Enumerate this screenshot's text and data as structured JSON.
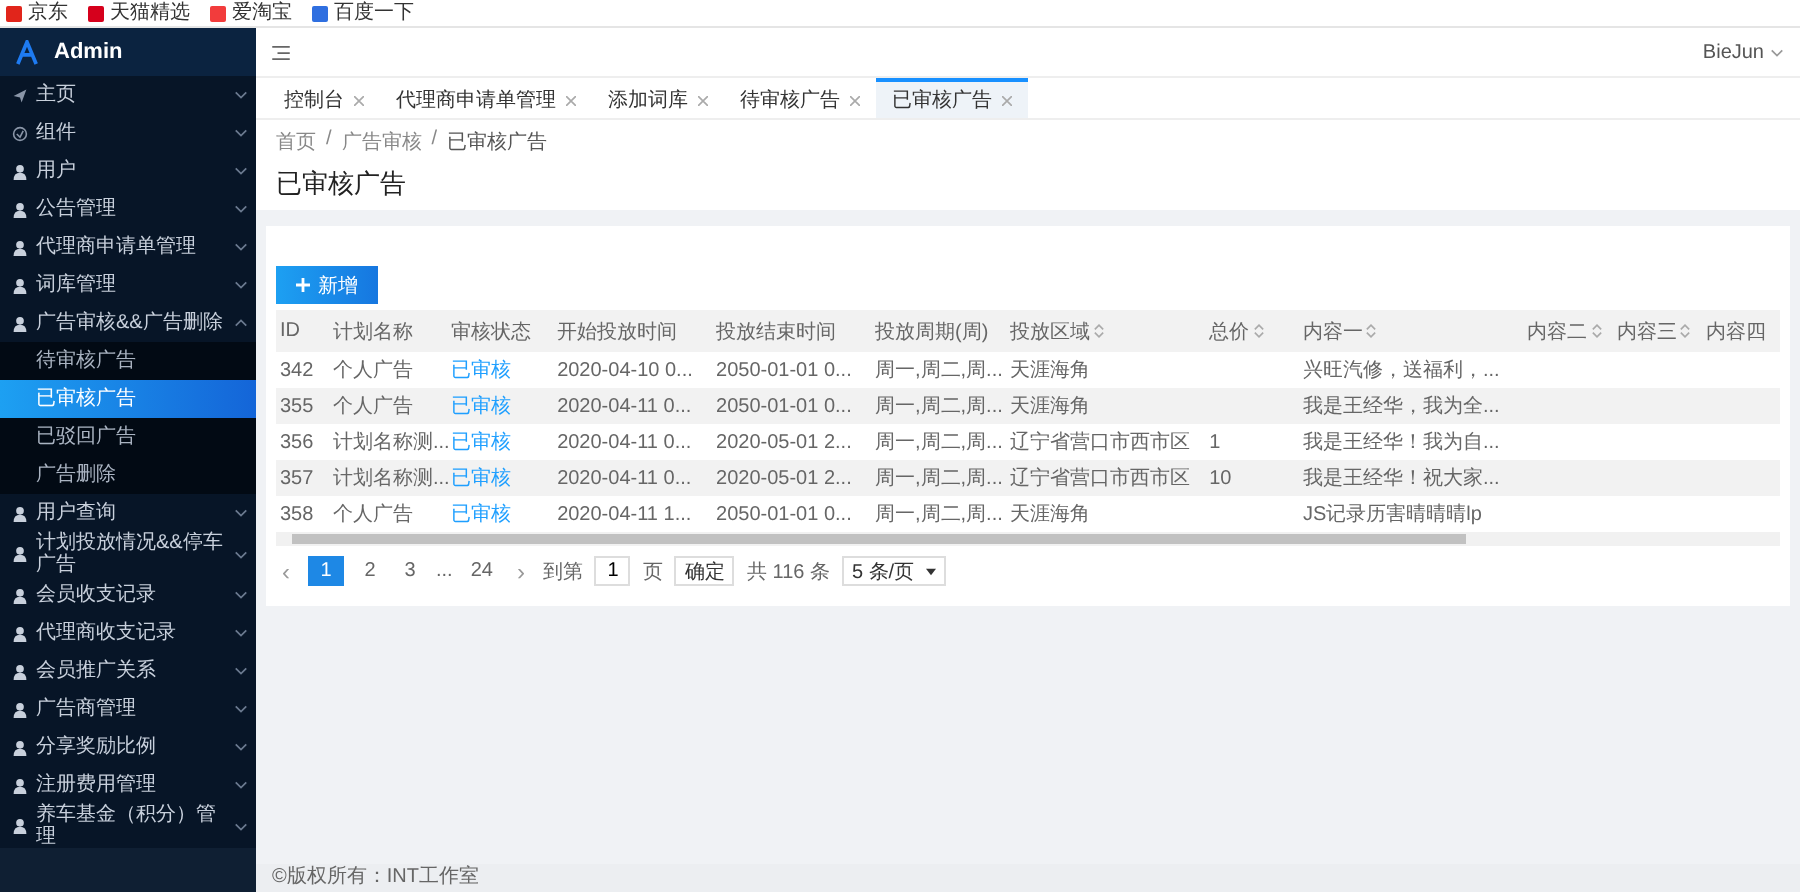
{
  "bookmarks": [
    {
      "label": "京东",
      "color": "#e1251b"
    },
    {
      "label": "天猫精选",
      "color": "#d6001c"
    },
    {
      "label": "爱淘宝",
      "color": "#f23c3c"
    },
    {
      "label": "百度一下",
      "color": "#2f6fe0"
    }
  ],
  "sidebar": {
    "title": "Admin",
    "items": [
      {
        "label": "主页",
        "expanded": false
      },
      {
        "label": "组件",
        "expanded": false
      },
      {
        "label": "用户",
        "expanded": false
      },
      {
        "label": "公告管理",
        "expanded": false
      },
      {
        "label": "代理商申请单管理",
        "expanded": false
      },
      {
        "label": "词库管理",
        "expanded": false
      },
      {
        "label": "广告审核&&广告删除",
        "expanded": true,
        "children": [
          {
            "label": "待审核广告",
            "selected": false
          },
          {
            "label": "已审核广告",
            "selected": true
          },
          {
            "label": "已驳回广告",
            "selected": false
          },
          {
            "label": "广告删除",
            "selected": false
          }
        ]
      },
      {
        "label": "用户查询",
        "expanded": false
      },
      {
        "label": "计划投放情况&&停车广告",
        "expanded": false
      },
      {
        "label": "会员收支记录",
        "expanded": false
      },
      {
        "label": "代理商收支记录",
        "expanded": false
      },
      {
        "label": "会员推广关系",
        "expanded": false
      },
      {
        "label": "广告商管理",
        "expanded": false
      },
      {
        "label": "分享奖励比例",
        "expanded": false
      },
      {
        "label": "注册费用管理",
        "expanded": false
      },
      {
        "label": "养车基金（积分）管理",
        "expanded": false
      }
    ]
  },
  "header": {
    "user": "BieJun"
  },
  "tabs": [
    {
      "label": "控制台",
      "selected": false
    },
    {
      "label": "代理商申请单管理",
      "selected": false
    },
    {
      "label": "添加词库",
      "selected": false
    },
    {
      "label": "待审核广告",
      "selected": false
    },
    {
      "label": "已审核广告",
      "selected": true
    }
  ],
  "breadcrumb": {
    "separator": "/",
    "items": [
      "首页",
      "广告审核",
      "已审核广告"
    ]
  },
  "page_title": "已审核广告",
  "add_button": "新增",
  "table": {
    "columns": [
      {
        "label": "ID",
        "sortable": false
      },
      {
        "label": "计划名称",
        "sortable": false
      },
      {
        "label": "审核状态",
        "sortable": false
      },
      {
        "label": "开始投放时间",
        "sortable": false
      },
      {
        "label": "投放结束时间",
        "sortable": false
      },
      {
        "label": "投放周期(周)",
        "sortable": false
      },
      {
        "label": "投放区域",
        "sortable": true
      },
      {
        "label": "总价",
        "sortable": true
      },
      {
        "label": "内容一",
        "sortable": true
      },
      {
        "label": "内容二",
        "sortable": true
      },
      {
        "label": "内容三",
        "sortable": true
      },
      {
        "label": "内容四",
        "sortable": false
      }
    ],
    "rows": [
      [
        "342",
        "个人广告",
        "已审核",
        "2020-04-10 0...",
        "2050-01-01 0...",
        "周一,周二,周...",
        "天涯海角",
        null,
        "兴旺汽修，送福利，...",
        null,
        null,
        null
      ],
      [
        "355",
        "个人广告",
        "已审核",
        "2020-04-11 0...",
        "2050-01-01 0...",
        "周一,周二,周...",
        "天涯海角",
        null,
        "我是王经华，我为全...",
        null,
        null,
        null
      ],
      [
        "356",
        "计划名称测...",
        "已审核",
        "2020-04-11 0...",
        "2020-05-01 2...",
        "周一,周二,周...",
        "辽宁省营口市西市区",
        "1",
        "我是王经华！我为自...",
        null,
        null,
        null
      ],
      [
        "357",
        "计划名称测...",
        "已审核",
        "2020-04-11 0...",
        "2020-05-01 2...",
        "周一,周二,周...",
        "辽宁省营口市西市区",
        "10",
        "我是王经华！祝大家...",
        null,
        null,
        null
      ],
      [
        "358",
        "个人广告",
        "已审核",
        "2020-04-11 1...",
        "2050-01-01 0...",
        "周一,周二,周...",
        "天涯海角",
        null,
        "JS记录历害晴晴晴lp",
        null,
        null,
        null
      ]
    ]
  },
  "pagination": {
    "prev": "‹",
    "pages": [
      {
        "label": "1",
        "selected": true
      },
      {
        "label": "2",
        "selected": false
      },
      {
        "label": "3",
        "selected": false
      }
    ],
    "ellipsis": "...",
    "last": "24",
    "next": "›",
    "goto_label": "到第",
    "goto_value": "1",
    "page_unit": "页",
    "confirm": "确定",
    "total": "共 116 条",
    "page_size": "5 条/页"
  },
  "footer": "©版权所有：INT工作室"
}
